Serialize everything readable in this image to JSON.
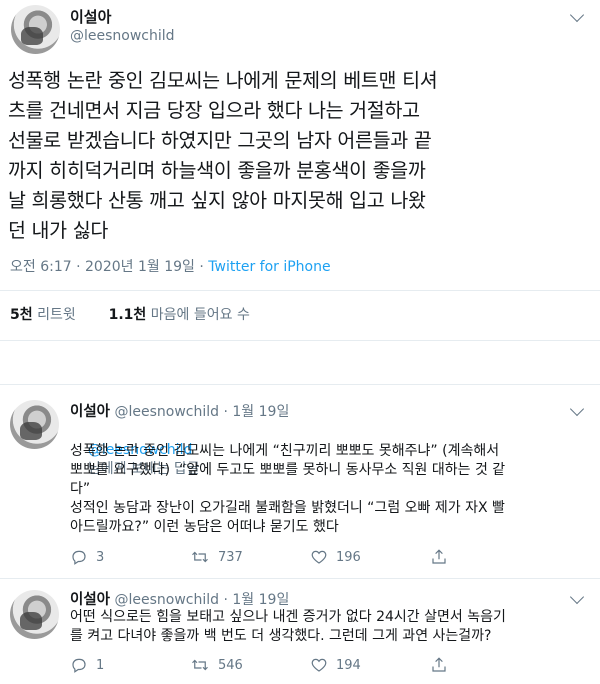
{
  "main_tweet": {
    "display_name": "이설아",
    "handle": "@leesnowchild",
    "text": "성폭행 논란 중인 김모씨는 나에게 문제의 베트맨 티셔\n츠를 건네면서 지금 당장 입으라 했다 나는 거절하고\n선물로 받겠습니다 하였지만 그곳의 남자 어른들과 끝\n까지 히히덕거리며 하늘색이 좋을까 분홍색이 좋을까\n날 희롱했다 산통 깨고 싶지 않아 마지못해 입고 나왔\n던 내가 싫다",
    "time": "오전 6:17",
    "date": "2020년 1월 19일",
    "separator": "·",
    "source": "Twitter for iPhone",
    "retweets_count": "5천",
    "retweets_label": "리트윗",
    "likes_count": "1.1천",
    "likes_label": "마음에 들어요 수"
  },
  "replies": [
    {
      "display_name": "이설아",
      "handle": "@leesnowchild",
      "date": "1월 19일",
      "reply_to_handle": "@leesnowchild",
      "reply_to_suffix": "님에게 보내는 답글",
      "text": "성폭행 논란 중인 김모씨는 나에게 “친구끼리 뽀뽀도 못해주냐” (계속해서\n뽀뽀를 요구했다)  “앞에 두고도 뽀뽀를 못하니 동사무소 직원 대하는 것 같\n다”\n성적인 농담과 장난이 오가길래 불쾌함을 밝혔더니 “그럼 오빠 제가 자X 빨\n아드릴까요?” 이런 농담은 어떠냐 묻기도 했다",
      "reply_count": "3",
      "retweet_count": "737",
      "like_count": "196"
    },
    {
      "display_name": "이설아",
      "handle": "@leesnowchild",
      "date": "1월 19일",
      "text": "어떤 식으로든 힘을 보태고 싶으나 내겐 증거가 없다 24시간 살면서 녹음기\n를 켜고 다녀야 좋을까 백 번도 더 생각했다. 그런데 그게 과연 사는걸까?",
      "reply_count": "1",
      "retweet_count": "546",
      "like_count": "194"
    }
  ],
  "icons": {
    "reply": "reply-icon",
    "retweet": "retweet-icon",
    "like": "heart-icon",
    "share": "share-icon",
    "more": "chevron-down-icon"
  },
  "colors": {
    "accent": "#1da1f2",
    "secondary_text": "#657786",
    "divider": "#e6ecf0"
  }
}
